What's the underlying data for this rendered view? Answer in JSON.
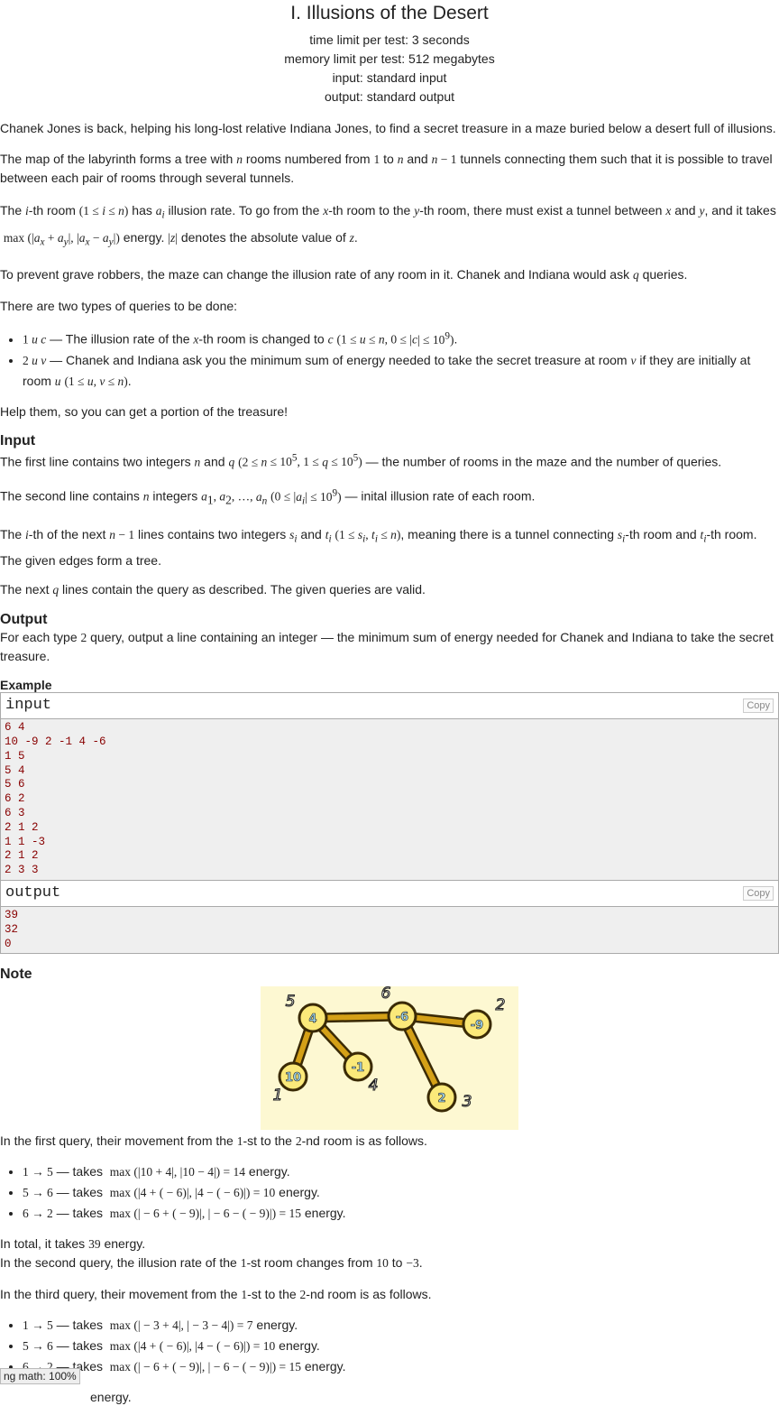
{
  "problem": {
    "title": "I. Illusions of the Desert",
    "time_limit": "time limit per test: 3 seconds",
    "memory_limit": "memory limit per test: 512 megabytes",
    "input_type": "input: standard input",
    "output_type": "output: standard output"
  },
  "statement": {
    "p1": "Chanek Jones is back, helping his long-lost relative Indiana Jones, to find a secret treasure in a maze buried below a desert full of illusions.",
    "p5": "There are two types of queries to be done:",
    "p6": "Help them, so you can get a portion of the treasure!"
  },
  "sections": {
    "input": "Input",
    "output": "Output",
    "example": "Example",
    "note": "Note"
  },
  "example": {
    "input_label": "input",
    "output_label": "output",
    "copy_label": "Copy",
    "input_lines": [
      "6 4",
      "10 -9 2 -1 4 -6",
      "1 5",
      "5 4",
      "5 6",
      "6 2",
      "6 3",
      "2 1 2",
      "1 1 -3",
      "2 1 2",
      "2 3 3"
    ],
    "output_lines": [
      "39",
      "32",
      "0"
    ]
  },
  "figure": {
    "nodes": [
      {
        "id": "5",
        "value": "4"
      },
      {
        "id": "6",
        "value": "-6"
      },
      {
        "id": "2",
        "value": "-9"
      },
      {
        "id": "1",
        "value": "10"
      },
      {
        "id": "4",
        "value": "-1"
      },
      {
        "id": "3",
        "value": "2"
      }
    ]
  },
  "zoom_label": "ng math: 100%",
  "colors": {
    "sample_text": "#880000",
    "sample_bg": "#efefef",
    "figure_bg": "#fdf8d2"
  }
}
